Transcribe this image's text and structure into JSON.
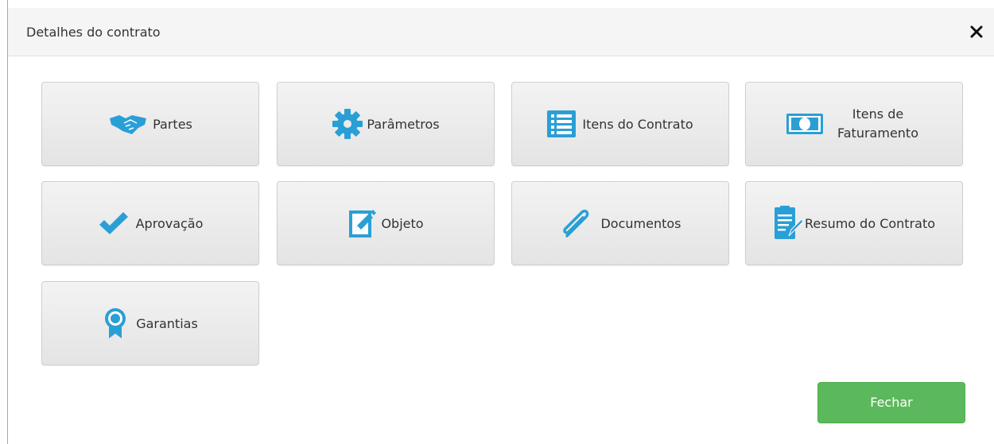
{
  "dialog": {
    "title": "Detalhes do contrato",
    "close_symbol": "×"
  },
  "tiles": [
    {
      "label": "Partes",
      "icon": "handshake-icon"
    },
    {
      "label": "Parâmetros",
      "icon": "gear-icon"
    },
    {
      "label": "Itens do Contrato",
      "icon": "list-icon"
    },
    {
      "label": "Itens de Faturamento",
      "icon": "money-icon"
    },
    {
      "label": "Aprovação",
      "icon": "checkmark-icon"
    },
    {
      "label": "Objeto",
      "icon": "edit-icon"
    },
    {
      "label": "Documentos",
      "icon": "paperclip-icon"
    },
    {
      "label": "Resumo do Contrato",
      "icon": "document-icon"
    },
    {
      "label": "Garantias",
      "icon": "award-icon"
    }
  ],
  "footer": {
    "close_label": "Fechar"
  },
  "colors": {
    "icon_blue": "#2a9fd6",
    "button_green": "#5cb85c",
    "header_bg": "#f5f5f5"
  }
}
